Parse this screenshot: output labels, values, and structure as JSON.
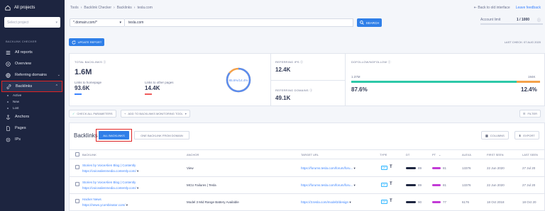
{
  "sidebar": {
    "all_projects": "All projects",
    "select_placeholder": "Select project",
    "section_heading": "BACKLINK CHECKER",
    "items": [
      {
        "label": "All reports",
        "icon": "list-icon"
      },
      {
        "label": "Overview",
        "icon": "target-icon"
      },
      {
        "label": "Referring domains",
        "icon": "globe-icon"
      },
      {
        "label": "Backlinks",
        "icon": "link-icon"
      },
      {
        "label": "Anchors",
        "icon": "anchor-icon"
      },
      {
        "label": "Pages",
        "icon": "page-icon"
      },
      {
        "label": "IPs",
        "icon": "ip-icon"
      }
    ],
    "sub_items": [
      "Active",
      "New",
      "Lost"
    ]
  },
  "topbar": {
    "crumbs": [
      "Tools",
      "Backlink Checker",
      "Backlinks",
      "tesla.com"
    ],
    "back_link": "Back to old interface",
    "feedback_link": "Leave feedback"
  },
  "search": {
    "scope": "*.domain.com/*",
    "query": "tesla.com",
    "button": "SEARCH",
    "account_limit_label": "Account limit",
    "account_limit_value": "1 / 1000"
  },
  "update_button": "UPDATE REPORT",
  "last_check": "LAST CHECK: 07 AUG 2020",
  "metrics": {
    "total_backlinks_label": "TOTAL BACKLINKS",
    "total_backlinks": "1.6M",
    "links_homepage_label": "Links to homepage",
    "links_homepage": "93.6K",
    "links_other_label": "Links to other pages",
    "links_other": "14.4K",
    "donut_label": "85.6%/14.4%",
    "referring_ips_label": "REFERRING IPS",
    "referring_ips": "12.4K",
    "referring_domains_label": "REFERRING DOMAINS",
    "referring_domains": "49.1K",
    "dofollow_label": "DOFOLLOW/NOFOLLOW",
    "dofollow_count": "1.37M",
    "nofollow_count": "194K",
    "dofollow_pct": "87.6%",
    "nofollow_pct": "12.4%",
    "dofollow_share": 0.876
  },
  "filters": {
    "check_all": "CHECK ALL PARAMETERS",
    "add_to_monitoring": "ADD TO BACKLINKS MONITORING TOOL",
    "filter": "FILTER"
  },
  "table": {
    "title": "Backlinks",
    "tab_all": "ALL BACKLINKS",
    "tab_one": "ONE BACKLINK FROM DOMAIN",
    "columns_btn": "COLUMNS",
    "export_btn": "EXPORT",
    "headers": [
      "BACKLINK",
      "ANCHOR",
      "TARGET URL",
      "TYPE",
      "DT",
      "PT",
      "ALEXA",
      "FIRST SEEN",
      "LAST SEEN"
    ],
    "rows": [
      {
        "title": "Stories by VoiceAlien Blog | Contently",
        "url": "https://voicealienmedia.contently.com/",
        "anchor": "View",
        "target": "https://forums.tesla.com/forum/foru...",
        "type": "DF",
        "dt": "89",
        "pt": "81",
        "alexa": "13376",
        "first": "22 Jun 2020",
        "last": "27 Jul 20"
      },
      {
        "title": "Stories by VoiceAlien Blog | Contently",
        "url": "https://voicealienmedia.contently.com/",
        "anchor": "MCU Failures | Tesla",
        "target": "https://forums.tesla.com/forum/foru...",
        "type": "DF",
        "dt": "89",
        "pt": "81",
        "alexa": "13376",
        "first": "22 Jun 2020",
        "last": "27 Jul 20"
      },
      {
        "title": "Hacker News",
        "url": "https://news.ycombinator.com/",
        "anchor": "Model 3 Mid Range Battery Available",
        "target": "https://3.tesla.com/model3/design",
        "type": "DF",
        "dt": "90",
        "pt": "77",
        "alexa": "6176",
        "first": "18 Oct 2018",
        "last": "18 Oct 20"
      }
    ]
  },
  "colors": {
    "accent": "#2f7fe8",
    "sidebar_bg": "#1d2540",
    "highlight": "#e02323",
    "nofollow": "#f4a24a",
    "dofollow": "#2dc8a8"
  }
}
